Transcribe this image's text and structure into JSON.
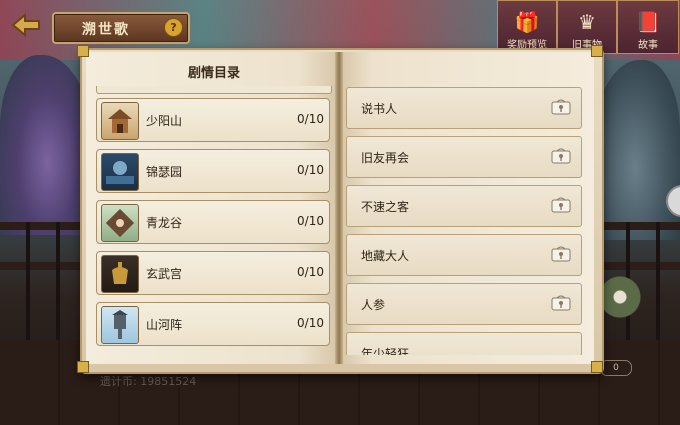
{
  "header": {
    "title": "溯世歌",
    "help_label": "?"
  },
  "top_icons": [
    {
      "label": "奖励预览",
      "icon": "gift-box-icon"
    },
    {
      "label": "旧事物",
      "icon": "crown-icon"
    },
    {
      "label": "故事",
      "icon": "storybook-icon"
    }
  ],
  "book": {
    "heading": "剧情目录",
    "chapters": [
      {
        "name": "少阳山",
        "progress": "0/10",
        "thumb": "pavilion-thumbnail"
      },
      {
        "name": "锦瑟园",
        "progress": "0/10",
        "thumb": "pond-garden-thumbnail"
      },
      {
        "name": "青龙谷",
        "progress": "0/10",
        "thumb": "dragon-emblem-thumbnail"
      },
      {
        "name": "玄武宫",
        "progress": "0/10",
        "thumb": "bronze-vessel-thumbnail"
      },
      {
        "name": "山河阵",
        "progress": "0/10",
        "thumb": "lantern-tower-thumbnail"
      }
    ],
    "stories": [
      {
        "name": "说书人",
        "icon": "locked-icon"
      },
      {
        "name": "旧友再会",
        "icon": "locked-icon"
      },
      {
        "name": "不速之客",
        "icon": "locked-icon"
      },
      {
        "name": "地藏大人",
        "icon": "locked-icon"
      },
      {
        "name": "人参",
        "icon": "locked-icon"
      },
      {
        "name": "年少轻狂",
        "icon": "locked-icon"
      }
    ]
  },
  "background": {
    "floor_text": "遗计币: 19851524",
    "counter": "0"
  },
  "colors": {
    "page": "#f4ecdc",
    "border": "#a98f66",
    "text": "#2e2418",
    "title_plate": "#5b3622"
  }
}
